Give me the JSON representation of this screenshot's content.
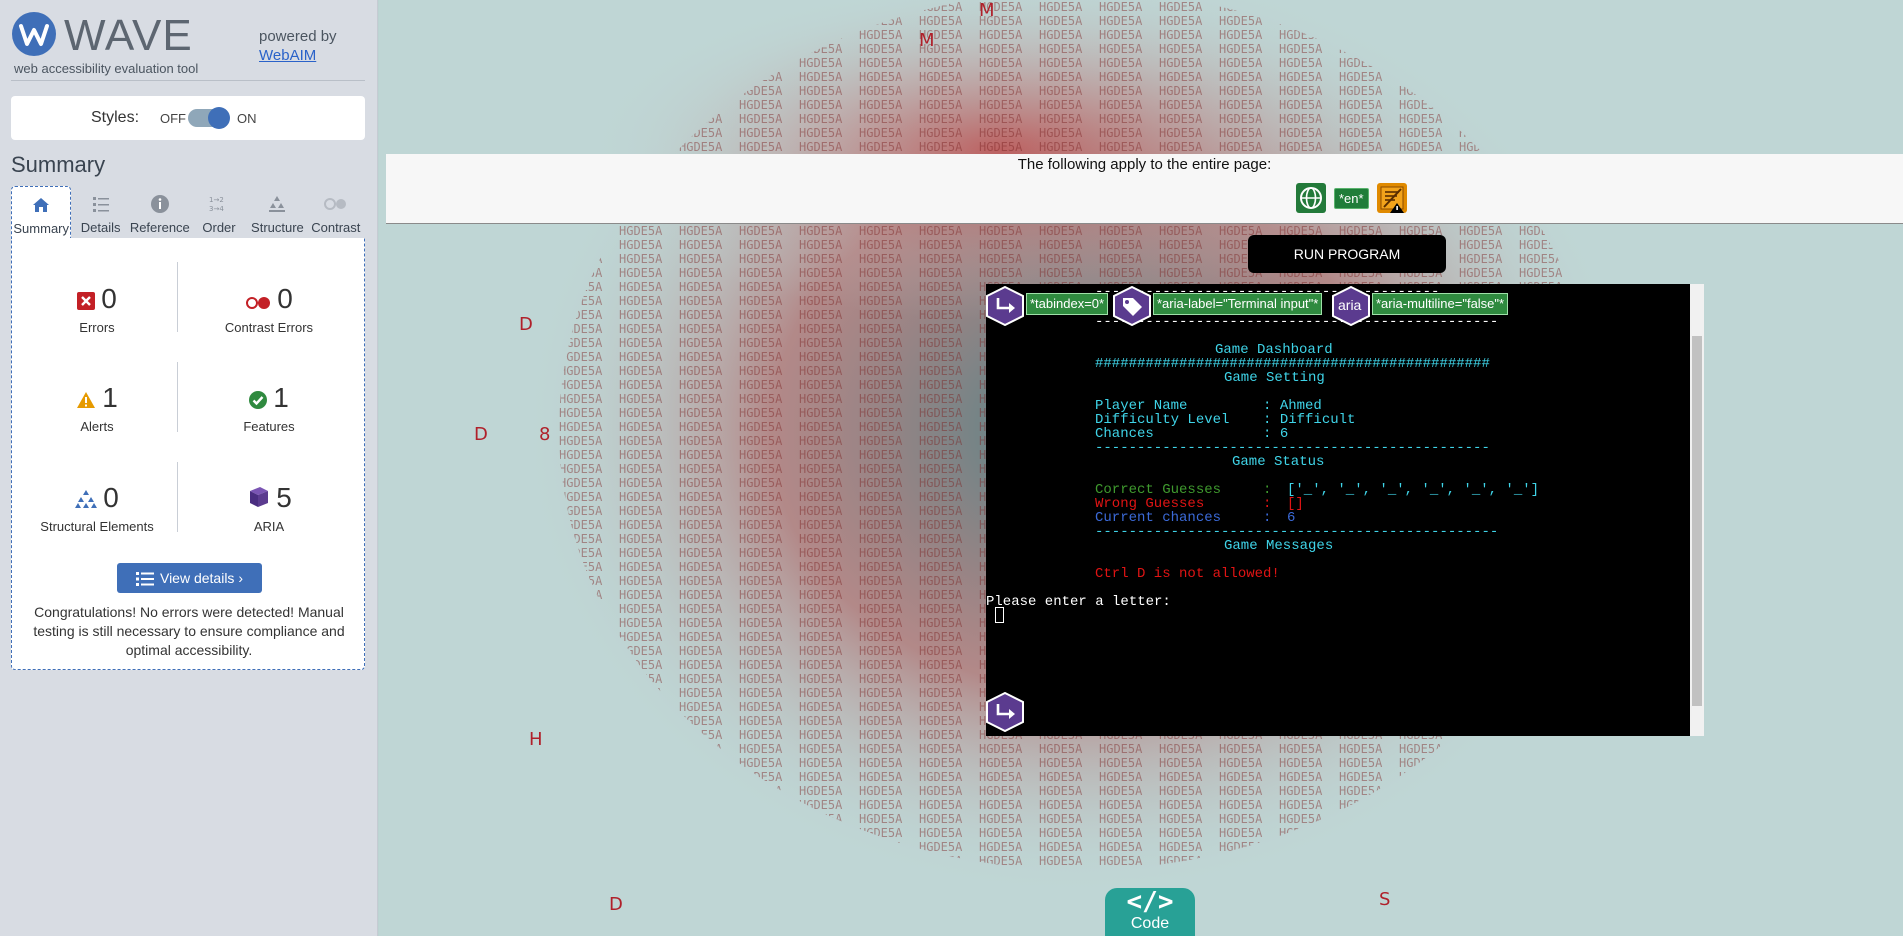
{
  "wave": {
    "title": "WAVE",
    "subtitle": "web accessibility evaluation tool",
    "powered_by": "powered by",
    "webaim_link": "WebAIM",
    "styles_label": "Styles:",
    "styles_off": "OFF",
    "styles_on": "ON",
    "summary_heading": "Summary",
    "tabs": [
      {
        "label": "Summary",
        "icon": "home-icon",
        "active": true
      },
      {
        "label": "Details",
        "icon": "list-icon"
      },
      {
        "label": "Reference",
        "icon": "info-icon"
      },
      {
        "label": "Order",
        "icon": "order-icon"
      },
      {
        "label": "Structure",
        "icon": "structure-icon"
      },
      {
        "label": "Contrast",
        "icon": "contrast-icon",
        "disabled": true
      }
    ],
    "stats": {
      "errors": {
        "count": "0",
        "label": "Errors",
        "color": "#c32026"
      },
      "contrast_errors": {
        "count": "0",
        "label": "Contrast Errors",
        "color": "#c32026"
      },
      "alerts": {
        "count": "1",
        "label": "Alerts",
        "color": "#e69a00"
      },
      "features": {
        "count": "1",
        "label": "Features",
        "color": "#2f8a3f"
      },
      "structural": {
        "count": "0",
        "label": "Structural Elements",
        "color": "#3f6fb8"
      },
      "aria": {
        "count": "5",
        "label": "ARIA",
        "color": "#5b3b8f"
      }
    },
    "view_details": "View details ›",
    "congrats": "Congratulations! No errors were detected! Manual testing is still necessary to ensure compliance and optimal accessibility."
  },
  "page": {
    "banner_text": "The following apply to the entire page:",
    "lang_badge": "*en*",
    "run_program": "RUN PROGRAM",
    "aria_labels": {
      "tabindex": "*tabindex=0*",
      "aria_label": "*aria-label=\"Terminal input\"*",
      "aria_word": "aria",
      "aria_multiline": "*aria-multiline=\"false\"*"
    },
    "terminal": {
      "sep_top": "-----------------------------------------",
      "sep_top2": "------------------------------------------------",
      "dashboard": "Game Dashboard",
      "hashes": "###############################################",
      "setting": "Game Setting",
      "player_name": "Player Name         : Ahmed",
      "difficulty": "Difficulty Level    : Difficult",
      "chances": "Chances             : 6",
      "sep_mid": "-----------------------------------------------",
      "status": "Game Status",
      "correct_label": "Correct Guesses     :",
      "correct_val": "['_', '_', '_', '_', '_', '_']",
      "wrong_label": "Wrong Guesses       :",
      "wrong_val": "[]",
      "current_label": "Current chances     :",
      "current_val": "6",
      "sep_mid2": "------------------------------------------------",
      "messages": "Game Messages",
      "ctrl_msg": "Ctrl D is not allowed!",
      "prompt": "Please enter a letter:"
    },
    "code_button": {
      "symbol": "</>",
      "label": "Code"
    }
  }
}
